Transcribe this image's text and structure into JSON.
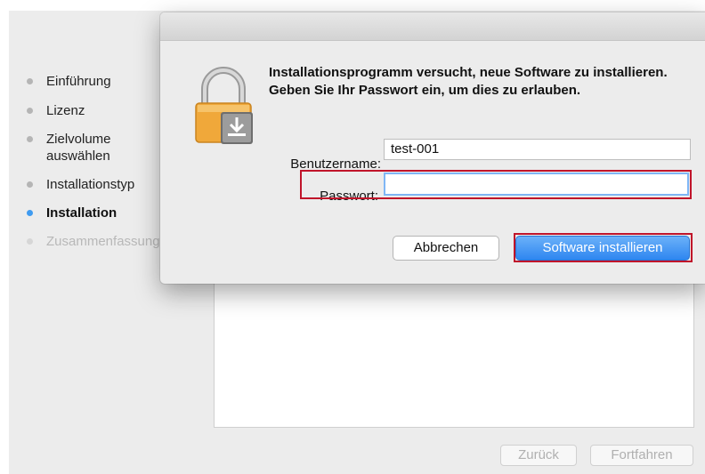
{
  "sidebar": {
    "steps": [
      {
        "label": "Einführung",
        "state": "done"
      },
      {
        "label": "Lizenz",
        "state": "done"
      },
      {
        "label": "Zielvolume auswählen",
        "state": "done"
      },
      {
        "label": "Installationstyp",
        "state": "done"
      },
      {
        "label": "Installation",
        "state": "current"
      },
      {
        "label": "Zusammenfassung",
        "state": "future"
      }
    ]
  },
  "navigation": {
    "back_label": "Zurück",
    "continue_label": "Fortfahren"
  },
  "auth_dialog": {
    "message": "Installationsprogramm versucht, neue Software zu installieren. Geben Sie Ihr Passwort ein, um dies zu erlauben.",
    "username_label": "Benutzername:",
    "username_value": "test-001",
    "password_label": "Passwort:",
    "password_value": "",
    "cancel_label": "Abbrechen",
    "install_label": "Software installieren",
    "icon": "lock-icon"
  },
  "colors": {
    "accent": "#3f9bf0",
    "highlight": "#c0142a",
    "lock_body": "#f0a83a"
  }
}
